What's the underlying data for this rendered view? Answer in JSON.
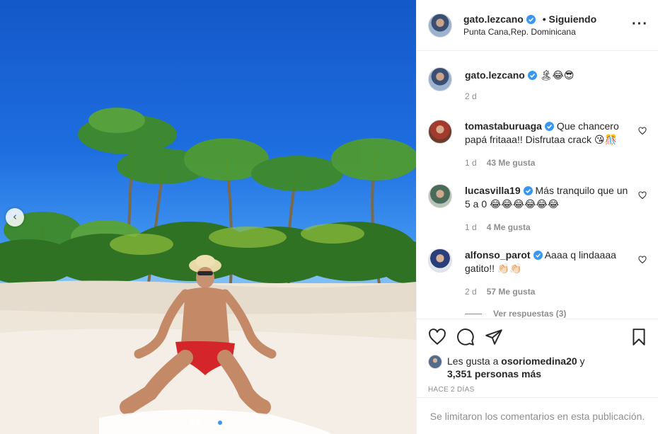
{
  "post": {
    "author": "gato.lezcano",
    "follow_status": "• Siguiendo",
    "location": "Punta Cana,Rep. Dominicana",
    "more_icon": "···",
    "caption_emojis": "🏝😂😎",
    "caption_time": "2 d"
  },
  "comments": [
    {
      "user": "tomastaburuaga",
      "text": "Que chancero papá fritaaa!! Disfrutaa crack 😘🎊",
      "time": "1 d",
      "likes": "43 Me gusta"
    },
    {
      "user": "lucasvilla19",
      "text": "Más tranquilo que un 5 a 0 😂😂😂😂😂😂",
      "time": "1 d",
      "likes": "4 Me gusta"
    },
    {
      "user": "alfonso_parot",
      "text": "Aaaa q lindaaaa gatito!! 👏🏻👏🏻",
      "time": "2 d",
      "likes": "57 Me gusta"
    }
  ],
  "view_replies": "Ver respuestas (3)",
  "likes": {
    "prefix": "Les gusta a",
    "user": "osoriomedina20",
    "and": "y",
    "others": "3,351 personas más"
  },
  "timestamp": "HACE 2 DÍAS",
  "comments_limited": "Se limitaron los comentarios en esta publicación.",
  "icons": {
    "prev": "chevron-left-icon",
    "like": "heart-icon",
    "comment": "comment-icon",
    "share": "send-icon",
    "save": "bookmark-icon",
    "verified": "verified-badge-icon"
  },
  "colors": {
    "verified": "#3897f0",
    "secondary_text": "#8e8e8e",
    "active_dot": "#3897f0"
  }
}
